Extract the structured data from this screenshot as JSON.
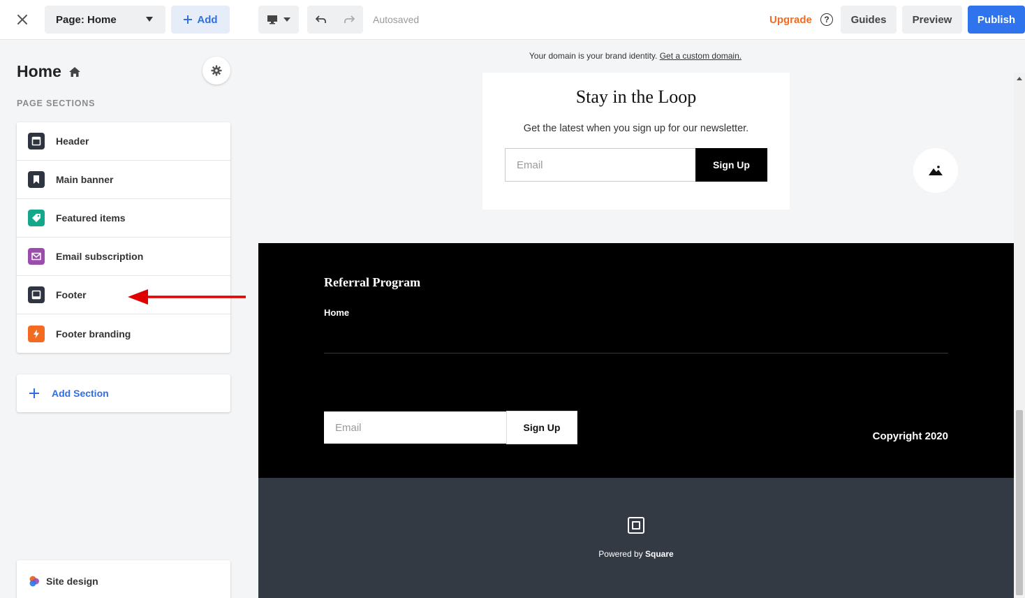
{
  "toolbar": {
    "page_select": "Page: Home",
    "add_label": "Add",
    "autosaved": "Autosaved",
    "upgrade": "Upgrade",
    "help": "?",
    "guides": "Guides",
    "preview": "Preview",
    "publish": "Publish"
  },
  "sidebar": {
    "title": "Home",
    "section_label": "PAGE SECTIONS",
    "sections": [
      {
        "label": "Header",
        "icon": "header-icon",
        "color": "#2e3440"
      },
      {
        "label": "Main banner",
        "icon": "bookmark-icon",
        "color": "#2e3440"
      },
      {
        "label": "Featured items",
        "icon": "tag-icon",
        "color": "#13a88a"
      },
      {
        "label": "Email subscription",
        "icon": "mail-icon",
        "color": "#9b4dae"
      },
      {
        "label": "Footer",
        "icon": "footer-icon",
        "color": "#2e3440"
      },
      {
        "label": "Footer branding",
        "icon": "lightning-icon",
        "color": "#f36b21"
      }
    ],
    "add_section": "Add Section",
    "site_design": "Site design"
  },
  "canvas": {
    "domain_text": "Your domain is your brand identity.",
    "domain_link": "Get a custom domain.",
    "newsletter": {
      "title": "Stay in the Loop",
      "subtitle": "Get the latest when you sign up for our newsletter.",
      "email_placeholder": "Email",
      "signup": "Sign Up"
    },
    "footer": {
      "title": "Referral Program",
      "link_home": "Home",
      "email_placeholder": "Email",
      "signup": "Sign Up",
      "copyright": "Copyright 2020"
    },
    "branding": {
      "powered_by": "Powered by",
      "brand": "Square"
    }
  },
  "colors": {
    "accent_blue": "#2f74ec",
    "upgrade_orange": "#f36b21",
    "annotation_red": "#e00000"
  }
}
